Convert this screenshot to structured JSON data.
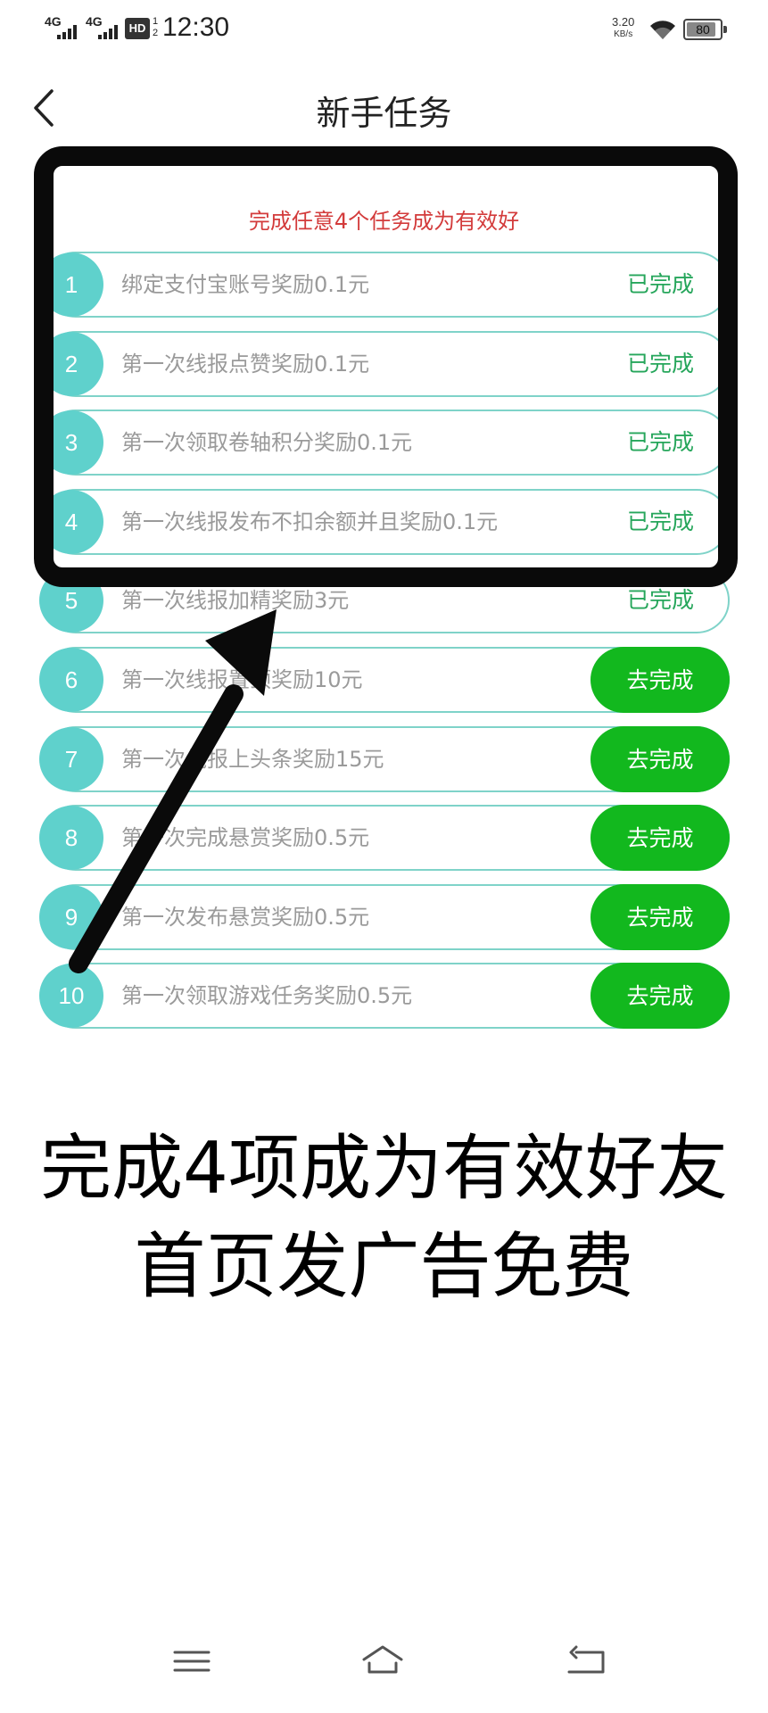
{
  "status_bar": {
    "signal_1": "4G",
    "signal_2": "4G",
    "hd_label": "HD",
    "hd_sub": "1 2",
    "time": "12:30",
    "net_speed": "3.20",
    "net_unit": "KB/s",
    "battery": "80"
  },
  "header": {
    "title": "新手任务"
  },
  "notice": "完成任意4个任务成为有效好",
  "tasks": [
    {
      "num": "1",
      "label": "绑定支付宝账号奖励0.1元",
      "status": "已完成",
      "done": true
    },
    {
      "num": "2",
      "label": "第一次线报点赞奖励0.1元",
      "status": "已完成",
      "done": true
    },
    {
      "num": "3",
      "label": "第一次领取卷轴积分奖励0.1元",
      "status": "已完成",
      "done": true
    },
    {
      "num": "4",
      "label": "第一次线报发布不扣余额并且奖励0.1元",
      "status": "已完成",
      "done": true
    },
    {
      "num": "5",
      "label": "第一次线报加精奖励3元",
      "status": "已完成",
      "done": true
    },
    {
      "num": "6",
      "label": "第一次线报置顶奖励10元",
      "status": "去完成",
      "done": false
    },
    {
      "num": "7",
      "label": "第一次线报上头条奖励15元",
      "status": "去完成",
      "done": false
    },
    {
      "num": "8",
      "label": "第一次完成悬赏奖励0.5元",
      "status": "去完成",
      "done": false
    },
    {
      "num": "9",
      "label": "第一次发布悬赏奖励0.5元",
      "status": "去完成",
      "done": false
    },
    {
      "num": "10",
      "label": "第一次领取游戏任务奖励0.5元",
      "status": "去完成",
      "done": false
    }
  ],
  "caption": {
    "line1": "完成4项成为有效好友",
    "line2": "首页发广告免费"
  },
  "colors": {
    "accent_teal": "#5fd1cc",
    "done_green": "#26a65b",
    "go_button": "#12b81e",
    "notice_red": "#d33b3b"
  },
  "icons": {
    "back": "chevron-left-icon",
    "nav_menu": "menu-icon",
    "nav_home": "home-icon",
    "nav_back": "return-icon"
  }
}
